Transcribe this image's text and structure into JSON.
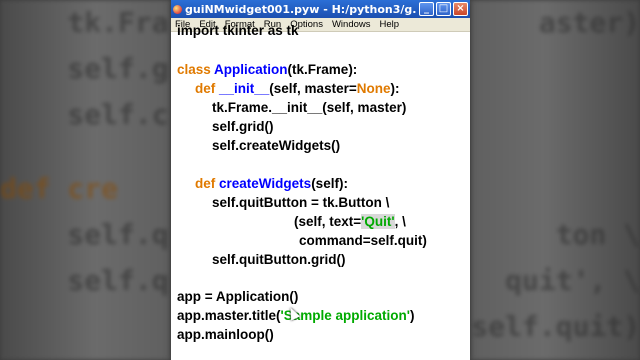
{
  "window": {
    "title": "guiNMwidget001.pyw - H:/python3/g...",
    "controls": {
      "minimize": "_",
      "maximize": "□",
      "close": "×"
    }
  },
  "menu": [
    "File",
    "Edit",
    "Format",
    "Run",
    "Options",
    "Windows",
    "Help"
  ],
  "code": {
    "line0": "import tkinter as tk",
    "line1": {
      "kw": "class",
      "name": "Application",
      "rest": "(tk.Frame):"
    },
    "line2": {
      "kw": "def",
      "name": "__init__",
      "pre": "(self, master=",
      "none": "None",
      "post": "):"
    },
    "line3": "tk.Frame.__init__(self, master)",
    "line4": "self.grid()",
    "line5": "self.createWidgets()",
    "line6": {
      "kw": "def",
      "name": "createWidgets",
      "rest": "(self):"
    },
    "line7": "self.quitButton = tk.Button \\",
    "line8": {
      "pre": "(self, text=",
      "str": "'Quit'",
      "post": ", \\"
    },
    "line9": "command=self.quit)",
    "line10": "self.quitButton.grid()",
    "line11": "app = Application()",
    "line12": {
      "pre": "app.master.title(",
      "str": "'Sample application'",
      "post": ")"
    },
    "line13": "app.mainloop()"
  }
}
